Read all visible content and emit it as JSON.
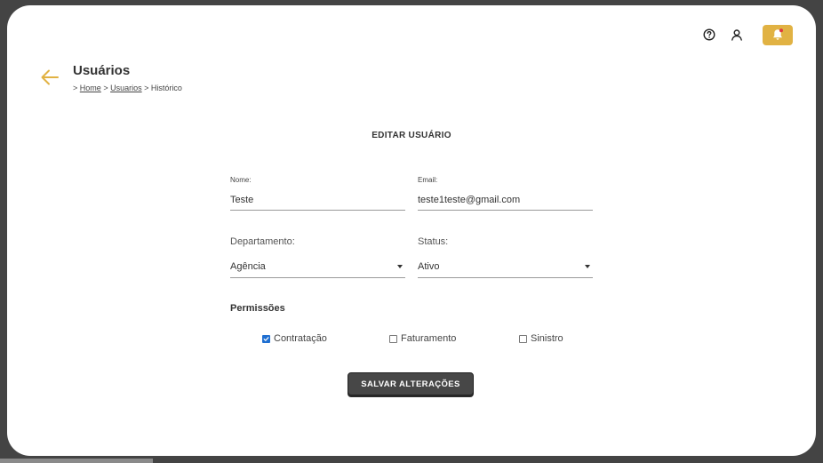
{
  "header": {
    "icons": [
      "help-icon",
      "user-icon",
      "bell-icon"
    ],
    "notification_dot_color": "#e0393e",
    "accent_color": "#e1b243"
  },
  "page": {
    "title": "Usuários",
    "breadcrumb": {
      "prefix": ">",
      "items": [
        "Home",
        "Usuarios",
        "Histórico"
      ],
      "separator": ">"
    }
  },
  "form": {
    "title": "EDITAR USUÁRIO",
    "nome": {
      "label": "Nome:",
      "value": "Teste"
    },
    "email": {
      "label": "Email:",
      "value": "teste1teste@gmail.com"
    },
    "departamento": {
      "label": "Departamento:",
      "value": "Agência"
    },
    "status": {
      "label": "Status:",
      "value": "Ativo"
    },
    "permissions": {
      "title": "Permissões",
      "items": [
        {
          "label": "Contratação",
          "checked": true
        },
        {
          "label": "Faturamento",
          "checked": false
        },
        {
          "label": "Sinistro",
          "checked": false
        }
      ]
    },
    "save_label": "SALVAR ALTERAÇÕES"
  }
}
